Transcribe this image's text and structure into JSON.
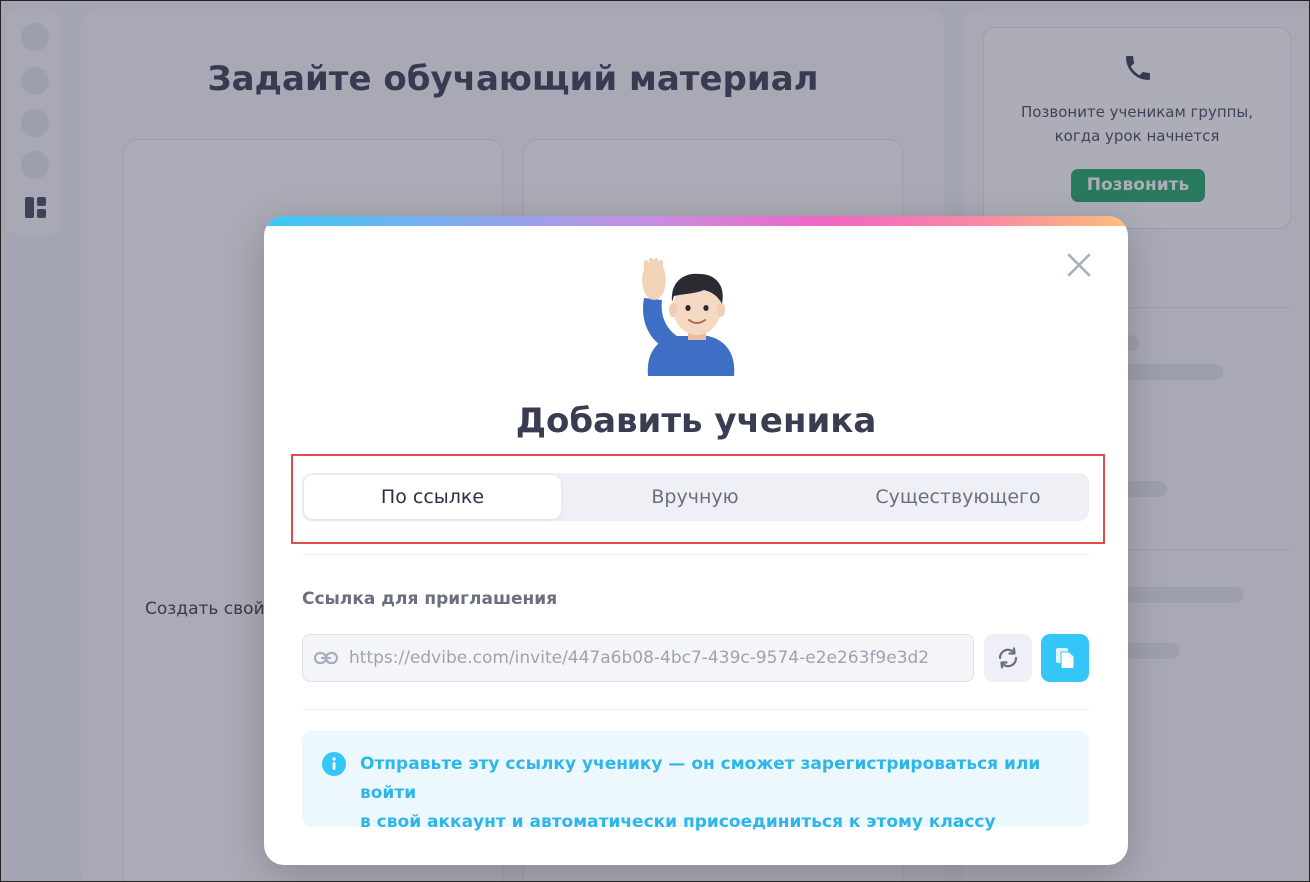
{
  "background": {
    "center_title": "Задайте обучающий материал",
    "create_label": "Создать свой",
    "call_card": {
      "text_line1": "Позвоните ученикам группы,",
      "text_line2": "когда урок начнется",
      "button_label": "Позвонить"
    }
  },
  "modal": {
    "title": "Добавить ученика",
    "tabs": [
      {
        "label": "По ссылке",
        "active": true
      },
      {
        "label": "Вручную",
        "active": false
      },
      {
        "label": "Существующего",
        "active": false
      }
    ],
    "invite": {
      "label": "Ссылка для приглашения",
      "link": "https://edvibe.com/invite/447a6b08-4bc7-439c-9574-e2e263f9e3d2"
    },
    "info_line1": "Отправьте эту ссылку ученику — он сможет зарегистрироваться или войти",
    "info_line2": "в свой аккаунт и автоматически присоединиться к этому классу"
  },
  "colors": {
    "accent": "#33c6f6",
    "call_button": "#12a05a",
    "highlight": "#e04a4a"
  },
  "icons": [
    "phone-icon",
    "close-icon",
    "link-icon",
    "refresh-icon",
    "copy-icon",
    "info-icon",
    "layout-icon",
    "person-raising-hand-emoji"
  ]
}
